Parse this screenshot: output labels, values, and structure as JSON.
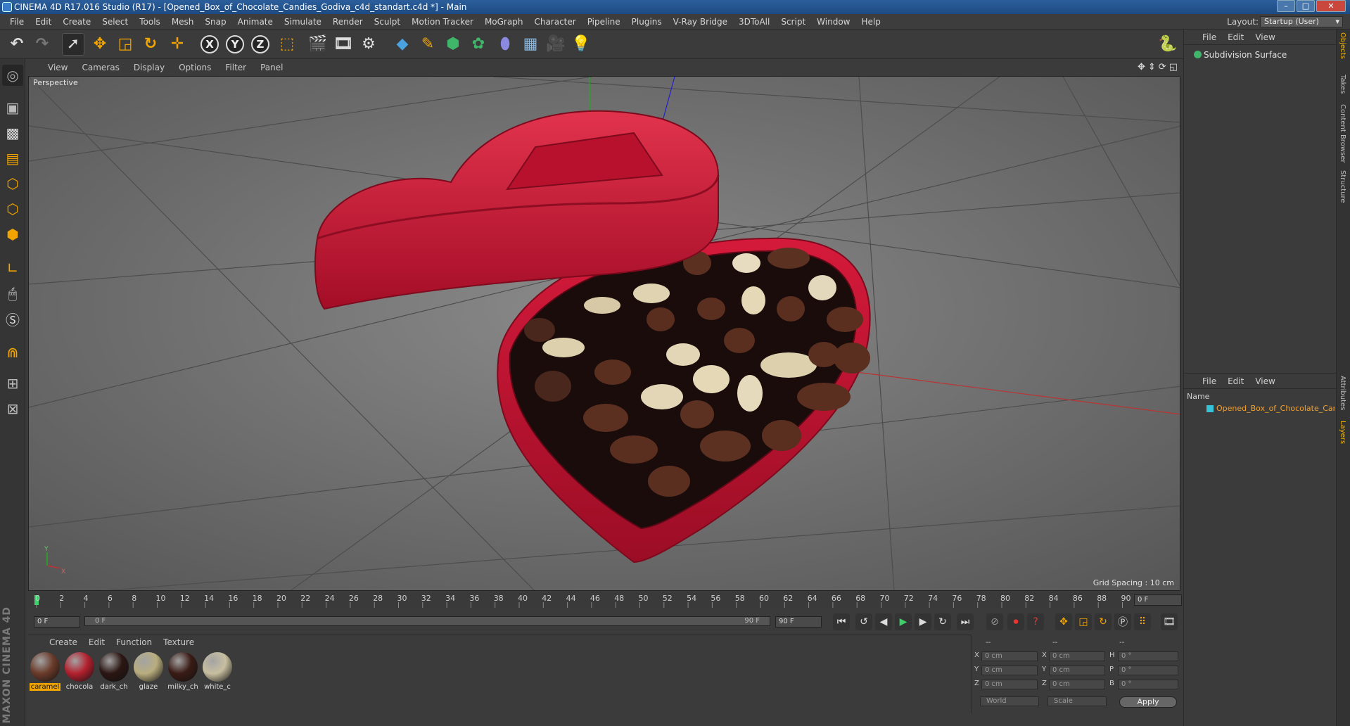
{
  "window": {
    "title": "CINEMA 4D R17.016 Studio (R17) - [Opened_Box_of_Chocolate_Candies_Godiva_c4d_standart.c4d *] - Main",
    "controls": [
      "–",
      "□",
      "✕"
    ]
  },
  "menubar": {
    "items": [
      "File",
      "Edit",
      "Create",
      "Select",
      "Tools",
      "Mesh",
      "Snap",
      "Animate",
      "Simulate",
      "Render",
      "Sculpt",
      "Motion Tracker",
      "MoGraph",
      "Character",
      "Pipeline",
      "Plugins",
      "V-Ray Bridge",
      "3DToAll",
      "Script",
      "Window",
      "Help"
    ],
    "layout_label": "Layout:",
    "layout_value": "Startup (User)"
  },
  "toolbar": {
    "axis_x": "X",
    "axis_y": "Y",
    "axis_z": "Z"
  },
  "viewport": {
    "menu": [
      "View",
      "Cameras",
      "Display",
      "Options",
      "Filter",
      "Panel"
    ],
    "label": "Perspective",
    "grid_spacing": "Grid Spacing : 10 cm",
    "axis_y": "Y",
    "axis_x": "X"
  },
  "timeline": {
    "ticks": [
      "0",
      "2",
      "4",
      "6",
      "8",
      "10",
      "12",
      "14",
      "16",
      "18",
      "20",
      "22",
      "24",
      "26",
      "28",
      "30",
      "32",
      "34",
      "36",
      "38",
      "40",
      "42",
      "44",
      "46",
      "48",
      "50",
      "52",
      "54",
      "56",
      "58",
      "60",
      "62",
      "64",
      "66",
      "68",
      "70",
      "72",
      "74",
      "76",
      "78",
      "80",
      "82",
      "84",
      "86",
      "88",
      "90"
    ],
    "current_frame": "0 F",
    "start_frame": "0 F",
    "scrub_start": "0 F",
    "scrub_end": "90 F",
    "end_frame": "90 F"
  },
  "material_manager": {
    "menu": [
      "Create",
      "Edit",
      "Function",
      "Texture"
    ],
    "materials": [
      {
        "label": "caramel",
        "color": "#6a3b2a",
        "selected": true
      },
      {
        "label": "chocola",
        "color": "#b3202e",
        "selected": false
      },
      {
        "label": "dark_ch",
        "color": "#2b1612",
        "selected": false
      },
      {
        "label": "glaze",
        "color": "#b9ad7e",
        "selected": false
      },
      {
        "label": "milky_ch",
        "color": "#3a1b15",
        "selected": false
      },
      {
        "label": "white_c",
        "color": "#c8bfa0",
        "selected": false
      }
    ]
  },
  "coordinates": {
    "header": [
      "--",
      "--",
      "--"
    ],
    "rows": [
      {
        "p": "X",
        "pv": "0 cm",
        "s": "X",
        "sv": "0 cm",
        "r": "H",
        "rv": "0 °"
      },
      {
        "p": "Y",
        "pv": "0 cm",
        "s": "Y",
        "sv": "0 cm",
        "r": "P",
        "rv": "0 °"
      },
      {
        "p": "Z",
        "pv": "0 cm",
        "s": "Z",
        "sv": "0 cm",
        "r": "B",
        "rv": "0 °"
      }
    ],
    "mode": "World",
    "scale_mode": "Scale",
    "apply": "Apply"
  },
  "object_manager": {
    "menu": [
      "File",
      "Edit",
      "View"
    ],
    "objects": [
      "Subdivision Surface"
    ]
  },
  "layer_manager": {
    "menu": [
      "File",
      "Edit",
      "View"
    ],
    "header": "Name",
    "layers": [
      "Opened_Box_of_Chocolate_Candi"
    ]
  },
  "right_tabs": [
    "Objects",
    "Takes",
    "Content Browser",
    "Structure",
    "Attributes",
    "Layers"
  ],
  "brand": "MAXON CINEMA 4D"
}
